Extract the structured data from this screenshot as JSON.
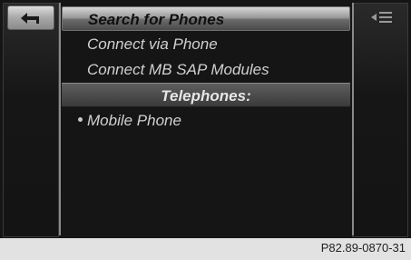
{
  "toolbar": {
    "back_icon": "back-arrow-icon",
    "menu_icon": "list-menu-icon"
  },
  "menu": {
    "items": [
      {
        "label": "Search for Phones",
        "selected": true
      },
      {
        "label": "Connect via Phone",
        "selected": false
      },
      {
        "label": "Connect MB SAP Modules",
        "selected": false
      }
    ],
    "section_header": "Telephones:",
    "devices": [
      {
        "label": "Mobile Phone"
      }
    ]
  },
  "caption": "P82.89-0870-31",
  "colors": {
    "screen_bg": "#151515",
    "text": "#d0d0d0",
    "selected_text": "#101010",
    "page_bg": "#e2e2e2"
  }
}
